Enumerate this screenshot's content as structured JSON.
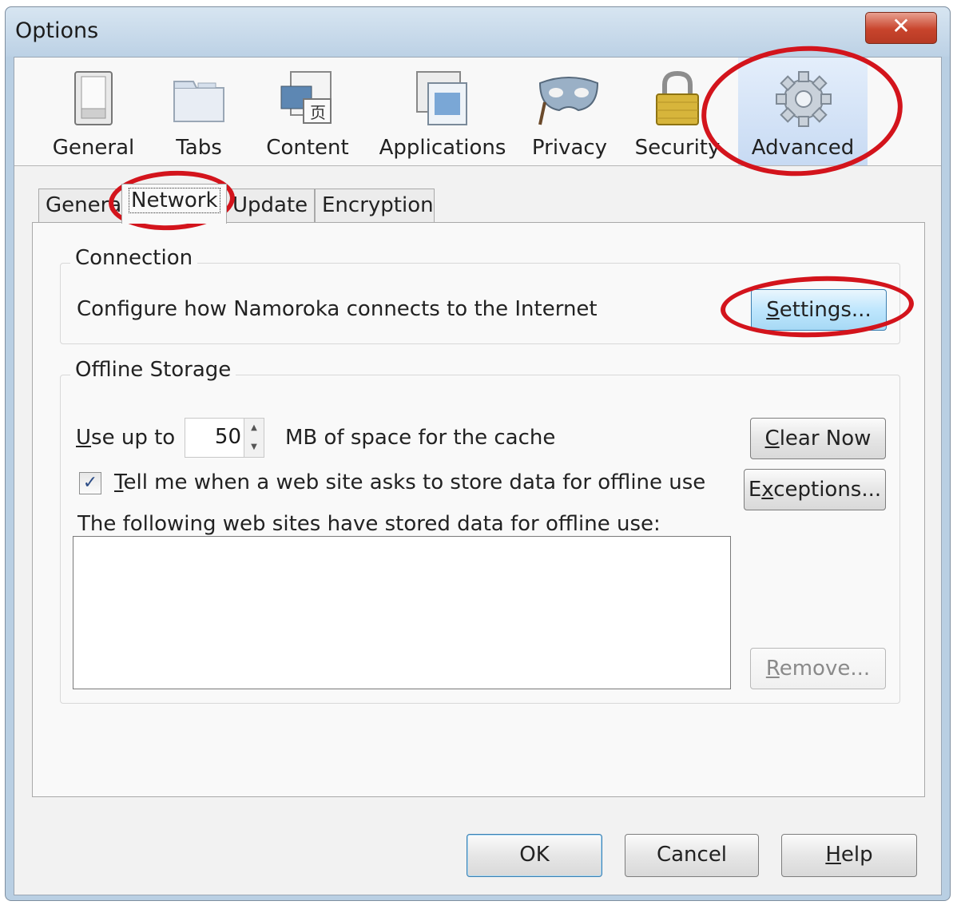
{
  "window": {
    "title": "Options",
    "close_glyph": "✕"
  },
  "categories": [
    {
      "id": "general",
      "label": "General",
      "icon": "switch-icon"
    },
    {
      "id": "tabs",
      "label": "Tabs",
      "icon": "folder-tabs-icon"
    },
    {
      "id": "content",
      "label": "Content",
      "icon": "content-page-icon"
    },
    {
      "id": "applications",
      "label": "Applications",
      "icon": "applications-icon"
    },
    {
      "id": "privacy",
      "label": "Privacy",
      "icon": "mask-icon"
    },
    {
      "id": "security",
      "label": "Security",
      "icon": "padlock-icon"
    },
    {
      "id": "advanced",
      "label": "Advanced",
      "icon": "gear-icon",
      "selected": true
    }
  ],
  "subtabs": [
    {
      "label": "General"
    },
    {
      "label": "Network",
      "active": true
    },
    {
      "label": "Update"
    },
    {
      "label": "Encryption"
    }
  ],
  "connection": {
    "legend": "Connection",
    "description": "Configure how Namoroka connects to the Internet",
    "settings_button": {
      "accel": "S",
      "rest": "ettings..."
    }
  },
  "offline": {
    "legend": "Offline Storage",
    "use_up_to": {
      "accel": "U",
      "rest": "se up to"
    },
    "cache_value": "50",
    "cache_suffix": "MB of space for the cache",
    "clear_now": {
      "accel": "C",
      "rest": "lear Now"
    },
    "notify_checked": true,
    "notify_label": {
      "accel": "T",
      "rest": "ell me when a web site asks to store data for offline use"
    },
    "exceptions": {
      "pre": "E",
      "accel": "x",
      "rest": "ceptions..."
    },
    "stored_label": "The following web sites have stored data for offline use:",
    "remove": {
      "accel": "R",
      "rest": "emove..."
    }
  },
  "footer": {
    "ok": "OK",
    "cancel": "Cancel",
    "help": {
      "accel": "H",
      "rest": "elp"
    }
  },
  "annotation_color": "#d3141c",
  "accent_color": "#3c7fb1"
}
